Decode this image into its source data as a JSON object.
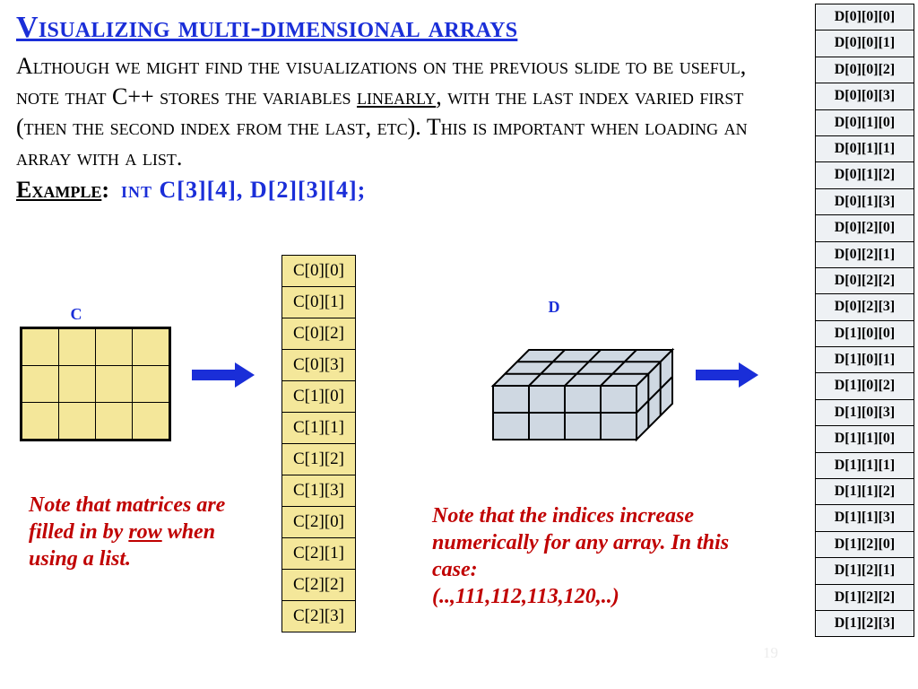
{
  "title": "Visualizing multi-dimensional arrays",
  "para_parts": {
    "p1": "Although we might find the visualizations on the previous slide to be useful, note that C++ stores the variables ",
    "linearly": "linearly",
    "p2": ", with the last index varied first (then the second index from the last, etc).  This is important when loading an array with a list."
  },
  "example": {
    "label": "Example",
    "decl": "int   C[3][4],   D[2][3][4];"
  },
  "c_label": "C",
  "d_label": "D",
  "c_cells": [
    "C[0][0]",
    "C[0][1]",
    "C[0][2]",
    "C[0][3]",
    "C[1][0]",
    "C[1][1]",
    "C[1][2]",
    "C[1][3]",
    "C[2][0]",
    "C[2][1]",
    "C[2][2]",
    "C[2][3]"
  ],
  "d_cells": [
    "D[0][0][0]",
    "D[0][0][1]",
    "D[0][0][2]",
    "D[0][0][3]",
    "D[0][1][0]",
    "D[0][1][1]",
    "D[0][1][2]",
    "D[0][1][3]",
    "D[0][2][0]",
    "D[0][2][1]",
    "D[0][2][2]",
    "D[0][2][3]",
    "D[1][0][0]",
    "D[1][0][1]",
    "D[1][0][2]",
    "D[1][0][3]",
    "D[1][1][0]",
    "D[1][1][1]",
    "D[1][1][2]",
    "D[1][1][3]",
    "D[1][2][0]",
    "D[1][2][1]",
    "D[1][2][2]",
    "D[1][2][3]"
  ],
  "note_left": {
    "p1": "Note that matrices are filled in by ",
    "row": "row",
    "p2": " when using a list."
  },
  "note_right": {
    "p1": "Note that the indices increase numerically for any array.  In this case:",
    "p2": "(..,111,112,113,120,..)"
  },
  "page_num": "19"
}
